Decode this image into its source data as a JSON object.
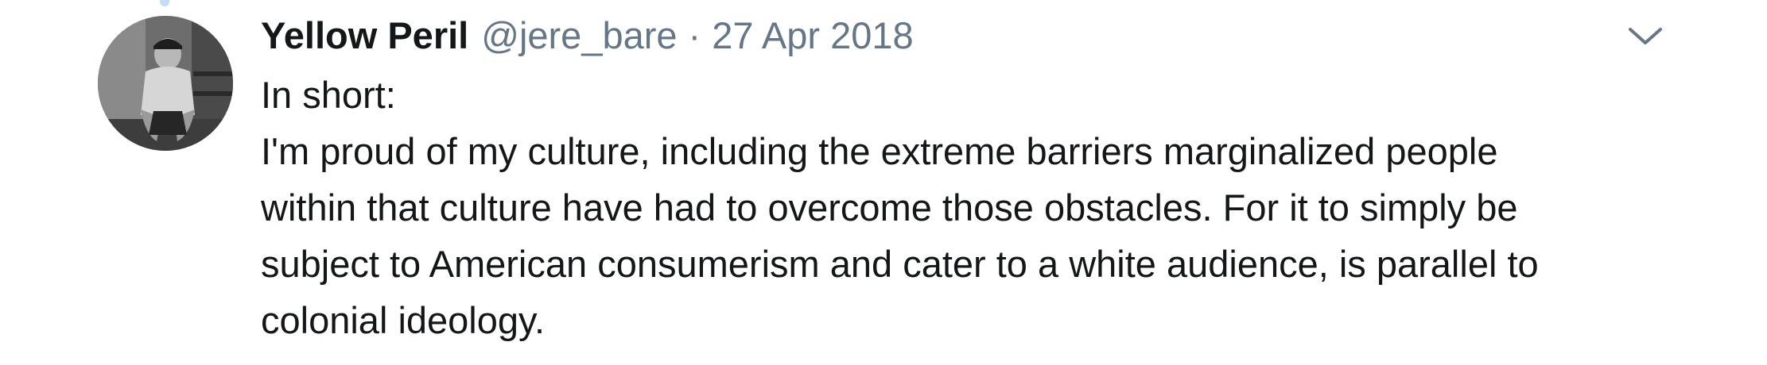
{
  "tweet": {
    "display_name": "Yellow Peril",
    "handle": "@jere_bare",
    "separator": "·",
    "timestamp": "27 Apr 2018",
    "text_lines": [
      "In short:",
      "I'm proud of my culture, including the extreme barriers marginalized people",
      "within that culture have had to overcome those obstacles. For it to simply be",
      "subject to American consumerism and cater to a white audience, is parallel to",
      "colonial ideology."
    ]
  },
  "icons": {
    "avatar": "avatar-photo",
    "menu": "chevron-down-icon"
  },
  "colors": {
    "name": "#14171a",
    "meta": "#657786",
    "thread_line": "#c4ddf2"
  }
}
